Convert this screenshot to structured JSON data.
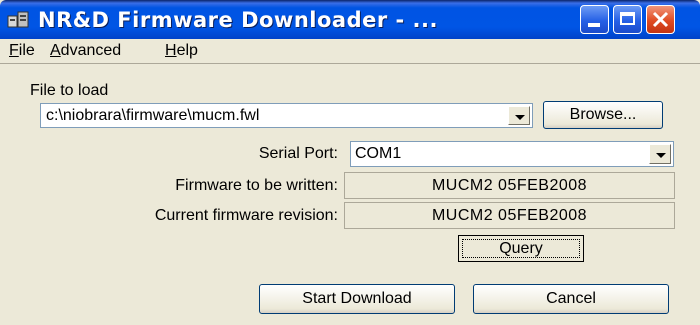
{
  "window": {
    "title": "NR&D Firmware Downloader - ..."
  },
  "menu": [
    {
      "label": "File"
    },
    {
      "label": "Advanced"
    },
    {
      "label": "Help"
    }
  ],
  "file_section": {
    "label": "File to load",
    "path_value": "c:\\niobrara\\firmware\\mucm.fwl",
    "browse_label": "Browse..."
  },
  "serial_port": {
    "label": "Serial Port:",
    "value": "COM1"
  },
  "firmware_to_write": {
    "label": "Firmware to be written:",
    "value": "MUCM2 05FEB2008"
  },
  "current_revision": {
    "label": "Current firmware revision:",
    "value": "MUCM2 05FEB2008"
  },
  "buttons": {
    "query": "Query",
    "start_download": "Start Download",
    "cancel": "Cancel"
  },
  "icons": [
    "app-icon",
    "minimize-icon",
    "maximize-icon",
    "close-icon",
    "dropdown-arrow-icon"
  ],
  "colors": {
    "titlebar": "#0054e3",
    "window_bg": "#ece9d8",
    "close_button": "#e04b22"
  }
}
